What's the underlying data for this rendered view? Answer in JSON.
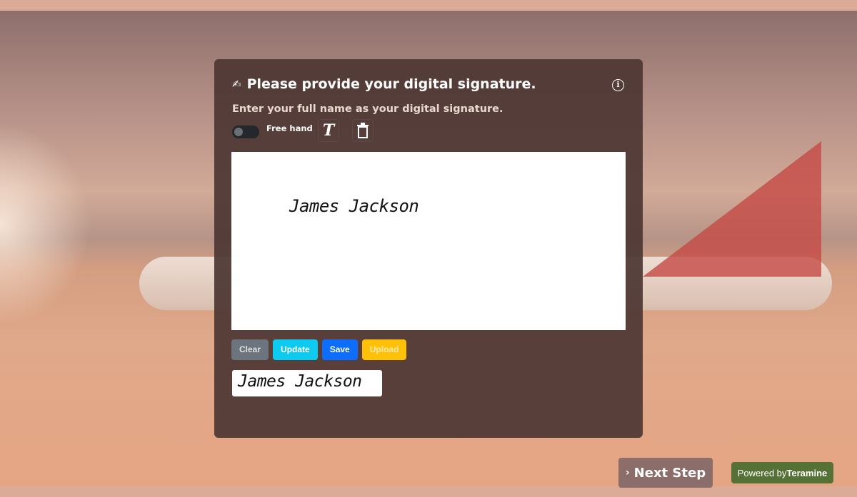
{
  "dialog": {
    "title": "Please provide your digital signature.",
    "subtitle": "Enter your full name as your digital signature.",
    "toggle_label": "Free hand",
    "toggle_on": false,
    "canvas_text": "James Jackson",
    "buttons": {
      "clear": "Clear",
      "update": "Update",
      "save": "Save",
      "upload": "Upload"
    },
    "signature_preview": "James Jackson"
  },
  "colors": {
    "clear": "#6c757d",
    "update": "#0dcaf0",
    "save": "#0d6efd",
    "upload": "#ffc107",
    "powered": "#567135"
  },
  "footer": {
    "next_step": "Next Step",
    "powered_by": "Powered by",
    "brand": "Teramine"
  }
}
